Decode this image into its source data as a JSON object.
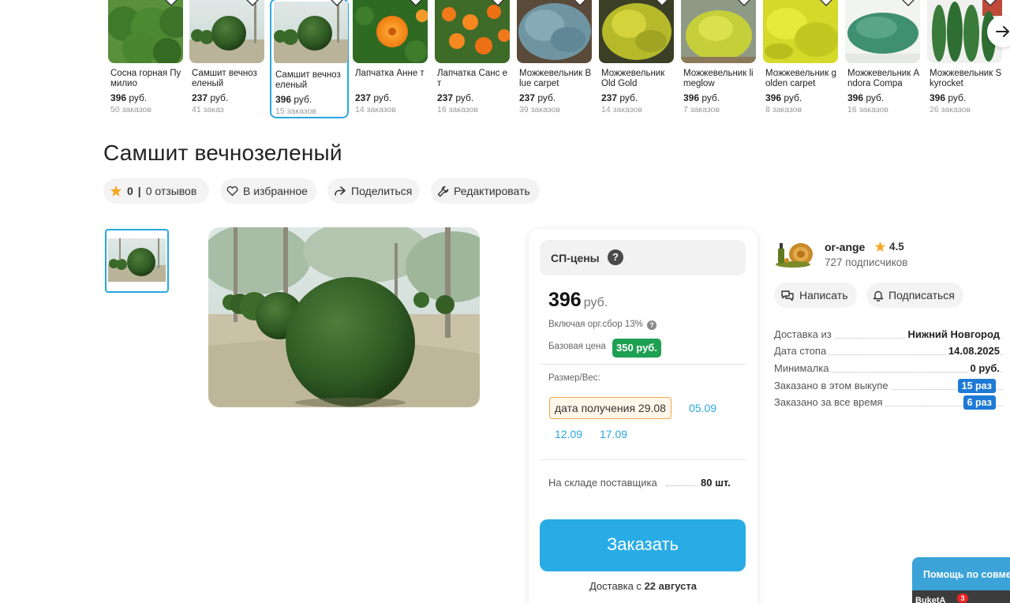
{
  "carousel": {
    "items": [
      {
        "name": "Сосна горная Пумилио",
        "price": "396",
        "currency": "руб.",
        "orders": "50 заказов",
        "image": "pine-shrub"
      },
      {
        "name": "Самшит вечноз еленый",
        "price": "237",
        "currency": "руб.",
        "orders": "41 заказ",
        "image": "boxwood-balls"
      },
      {
        "name": "Самшит вечноз еленый",
        "price": "396",
        "currency": "руб.",
        "orders": "15 заказов",
        "image": "boxwood-balls",
        "selected": true
      },
      {
        "name": "Лапчатка Анне т",
        "price": "237",
        "currency": "руб.",
        "orders": "14 заказов",
        "image": "orange-flower"
      },
      {
        "name": "Лапчатка Санс ет",
        "price": "237",
        "currency": "руб.",
        "orders": "16 заказов",
        "image": "orange-flowers"
      },
      {
        "name": "Можжевельник Blue carpet",
        "price": "237",
        "currency": "руб.",
        "orders": "39 заказов",
        "image": "blue-juniper"
      },
      {
        "name": "Можжевельник Old Gold",
        "price": "237",
        "currency": "руб.",
        "orders": "14 заказов",
        "image": "gold-juniper"
      },
      {
        "name": "Можжевельник limeglow",
        "price": "396",
        "currency": "руб.",
        "orders": "7 заказов",
        "image": "lime-juniper"
      },
      {
        "name": "Можжевельник golden carpet",
        "price": "396",
        "currency": "руб.",
        "orders": "8 заказов",
        "image": "golden-carpet"
      },
      {
        "name": "Можжевельник Andora Compa",
        "price": "396",
        "currency": "руб.",
        "orders": "16 заказов",
        "image": "andorra-juniper"
      },
      {
        "name": "Можжевельник Skyrocket",
        "price": "396",
        "currency": "руб.",
        "orders": "26 заказов",
        "image": "skyrocket-juniper"
      }
    ],
    "next_icon": "arrow-right-icon"
  },
  "product": {
    "title": "Самшит вечнозеленый",
    "rating_value": "0",
    "rating_sep": "|",
    "reviews": "0 отзывов",
    "favorite": "В избранное",
    "share": "Поделиться",
    "edit": "Редактировать"
  },
  "buy": {
    "sp_label": "СП-цены",
    "sp_help": "?",
    "price": "396",
    "currency": "руб.",
    "incl": "Включая орг.сбор 13%",
    "incl_help": "?",
    "base_label": "Базовая цена",
    "base_price": "350 руб.",
    "size_label": "Размер/Вес:",
    "date_selected": "дата получения 29.08",
    "dates": [
      "05.09",
      "12.09",
      "17.09"
    ],
    "stock_label": "На складе поставщика",
    "stock_value": "80 шт.",
    "order_button": "Заказать",
    "delivery_prefix": "Доставка с",
    "delivery_date": "22 августа"
  },
  "seller": {
    "name": "or-ange",
    "rating": "4.5",
    "subscribers": "727 подписчиков",
    "write": "Написать",
    "subscribe": "Подписаться",
    "info": [
      {
        "label": "Доставка из",
        "value": "Нижний Новгород"
      },
      {
        "label": "Дата стопа",
        "value": "14.08.2025"
      },
      {
        "label": "Минималка",
        "value": "0 руб."
      },
      {
        "label": "Заказано в этом выкупе",
        "badge": "15 раз"
      },
      {
        "label": "Заказано за все время",
        "badge": "6 раз"
      }
    ]
  },
  "help": {
    "title": "Помощь по совме",
    "user": "BuketA",
    "count": "3"
  },
  "colors": {
    "accent": "#29a7e1",
    "order_button": "#29ace6",
    "base_badge": "#1ea052",
    "count_badge": "#1f7ad6",
    "star": "#f5a623"
  }
}
